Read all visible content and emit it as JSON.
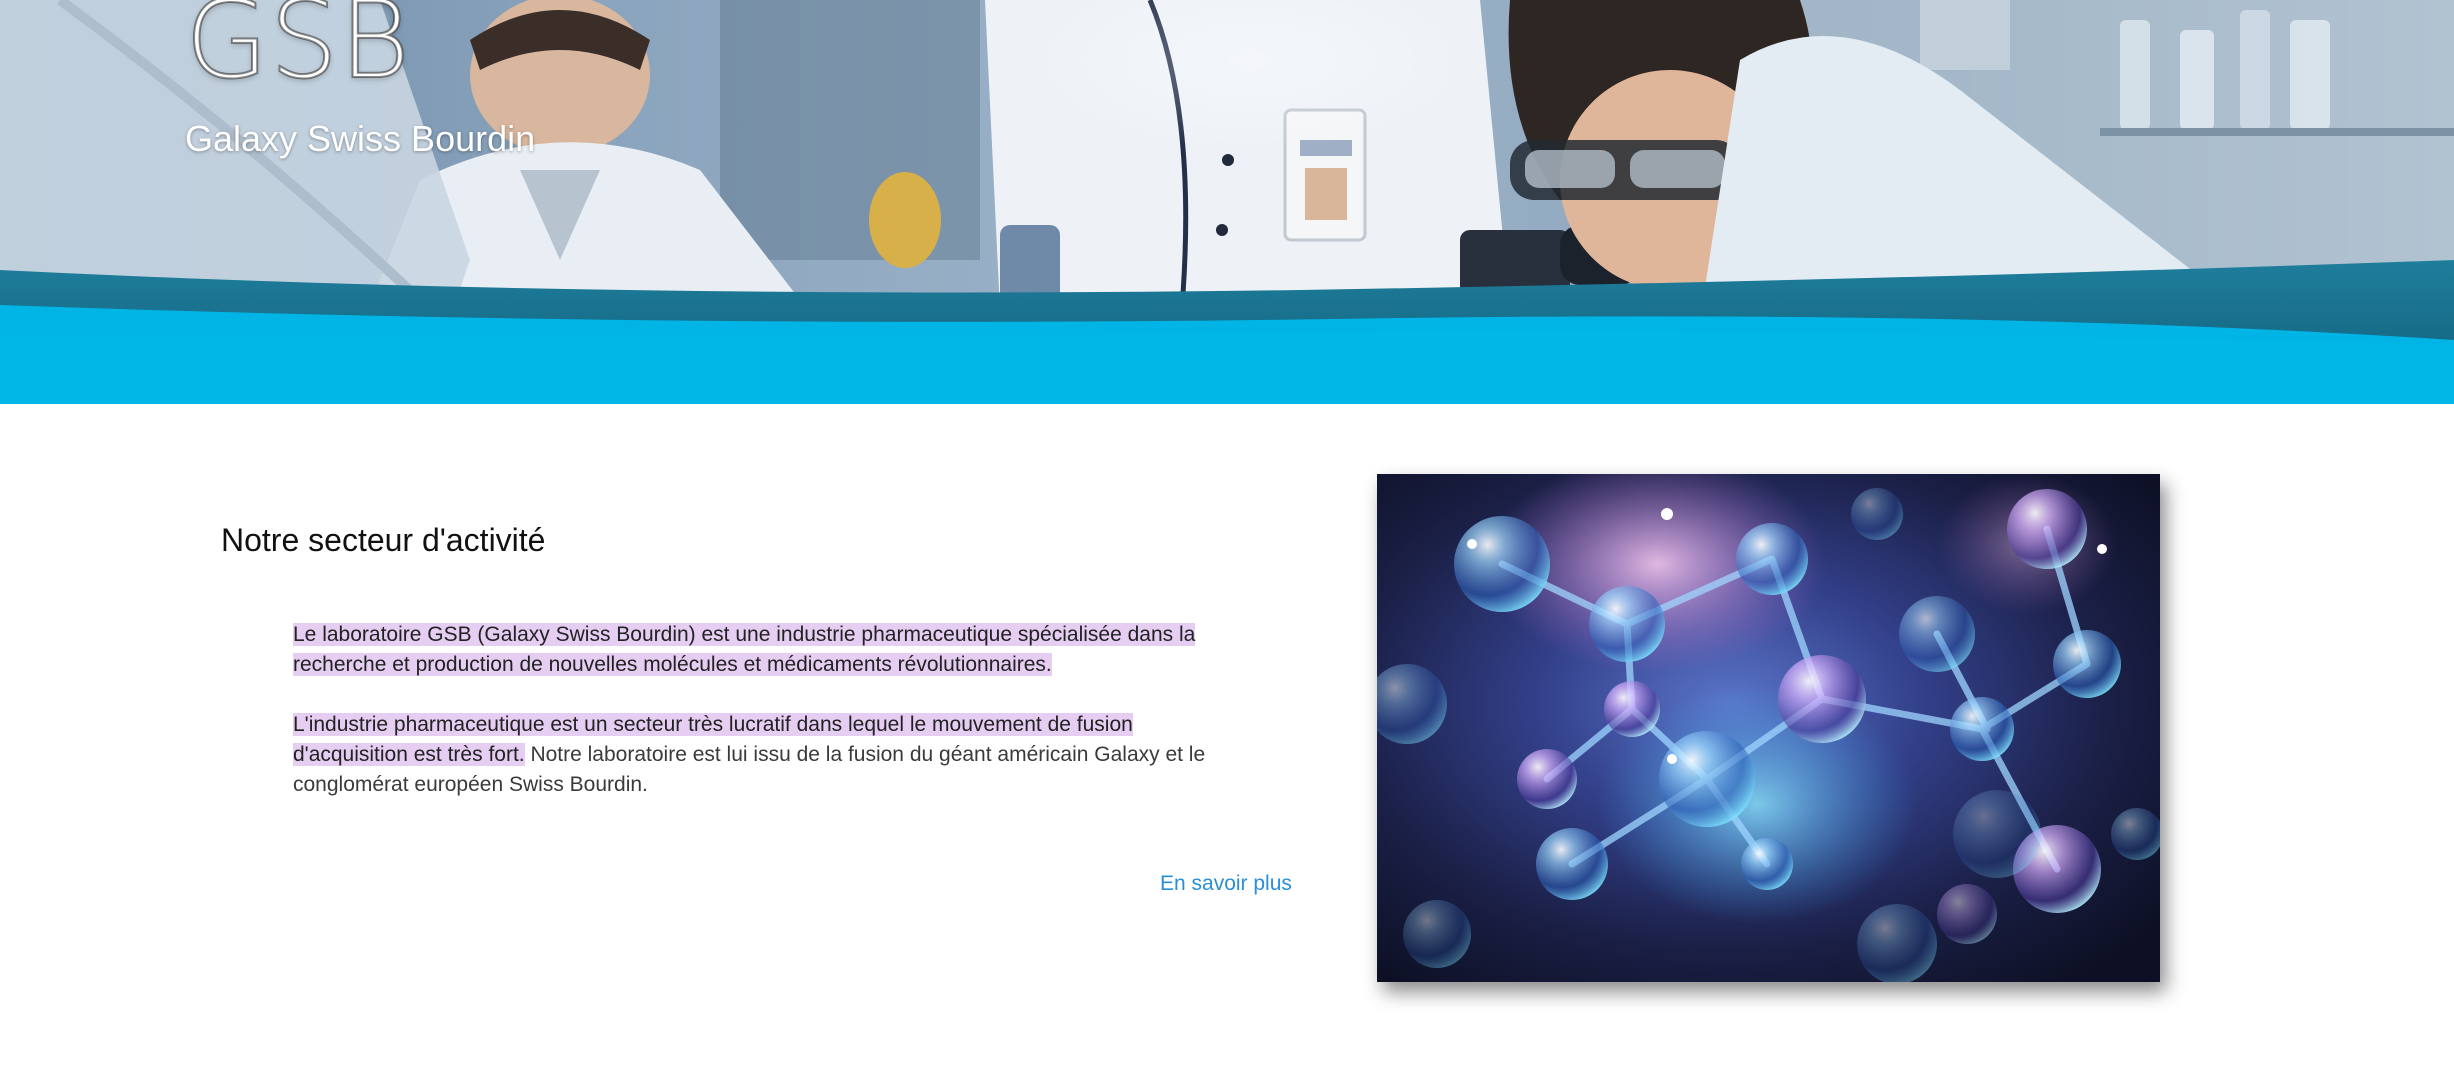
{
  "hero": {
    "title": "GSB",
    "subtitle": "Galaxy Swiss Bourdin"
  },
  "section": {
    "title": "Notre secteur d'activité",
    "paragraph1_highlight": "Le laboratoire GSB (Galaxy Swiss Bourdin) est une industrie pharmaceutique spécialisée dans la recherche et production de nouvelles molécules et médicaments révolutionnaires.",
    "paragraph2_highlight": "L'industrie pharmaceutique est un secteur très lucratif dans lequel le mouvement de fusion d'acquisition est très fort.",
    "paragraph2_rest": " Notre laboratoire est lui issu de la fusion du géant américain Galaxy et le conglomérat européen Swiss Bourdin.",
    "more_link": "En savoir plus"
  },
  "colors": {
    "accent_blue": "#00b5e6",
    "link_blue": "#2a8fd8",
    "highlight": "#e6cdf2"
  },
  "icons": {
    "hero_image": "laboratory-scientists-photo",
    "illustration": "molecules-illustration"
  }
}
